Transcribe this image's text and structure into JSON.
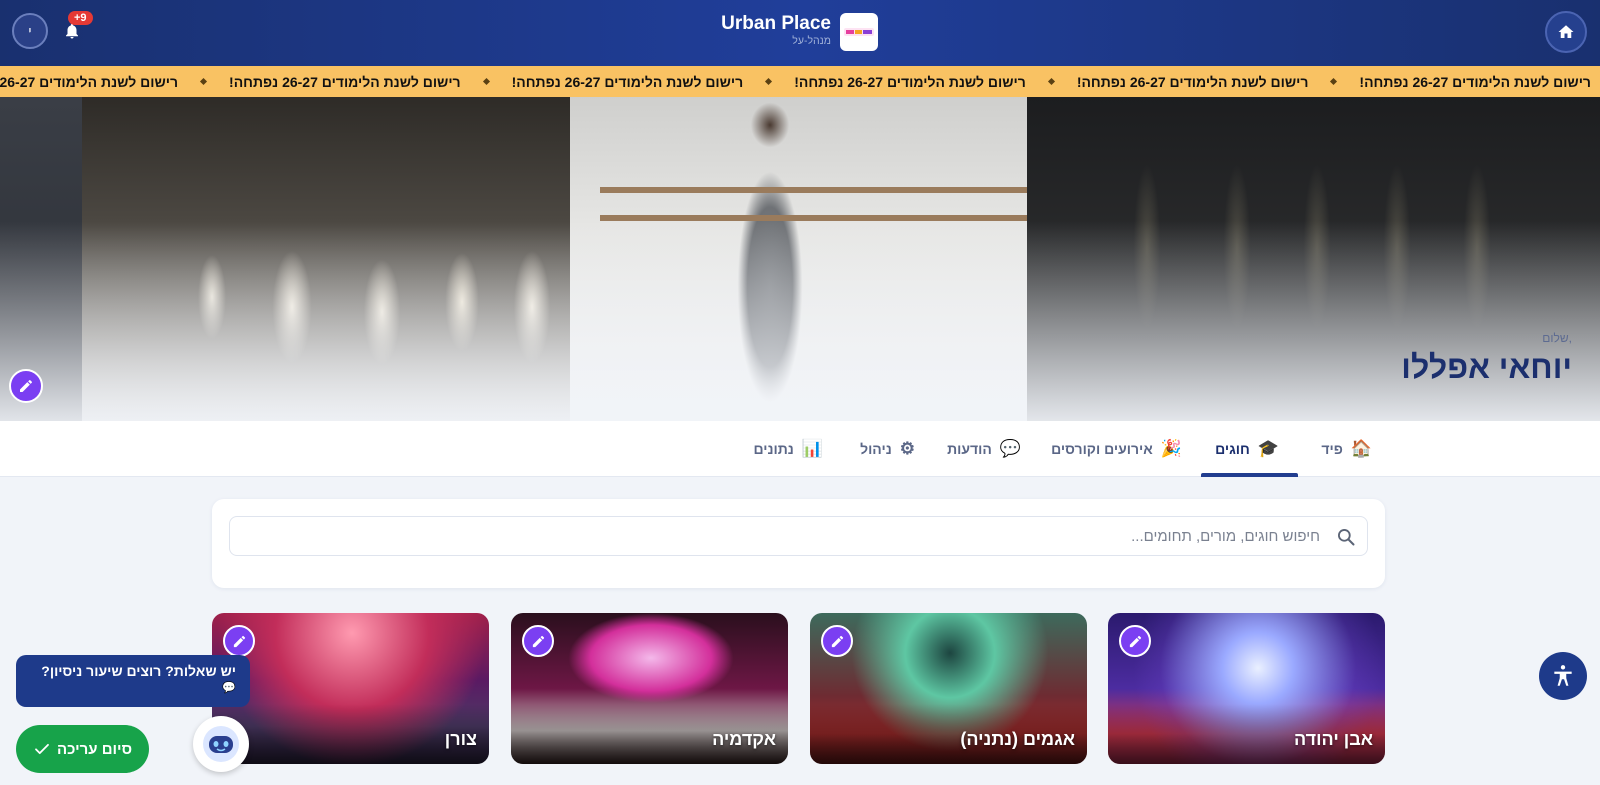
{
  "header": {
    "brand_title": "Urban Place",
    "brand_subtitle": "מנהל-על",
    "brand_logo_text": "Urban Place",
    "notification_count": "+9",
    "avatar_initial": "י",
    "icons": {
      "home": "home-icon",
      "bell": "bell-icon"
    }
  },
  "ticker": {
    "items": [
      "רישום לשנת הלימודים 26-27 נפתחה!",
      "רישום לשנת הלימודים 26-27 נפתחה!",
      "רישום לשנת הלימודים 26-27 נפתחה!",
      "רישום לשנת הלימודים 26-27 נפתחה!",
      "רישום לשנת הלימודים 26-27 נפתחה!",
      "רישום לשנת הלימודים 26-27 נפתחה!"
    ]
  },
  "hero": {
    "greeting": "שלום,",
    "user_name": "יוחאי אפללו"
  },
  "tabs": [
    {
      "label": "פיד",
      "icon": "🏠",
      "active": false
    },
    {
      "label": "חוגים",
      "icon": "🎓",
      "active": true
    },
    {
      "label": "אירועים וקורסים",
      "icon": "🎉",
      "active": false
    },
    {
      "label": "הודעות",
      "icon": "💬",
      "active": false
    },
    {
      "label": "ניהול",
      "icon": "⚙",
      "active": false
    },
    {
      "label": "נתונים",
      "icon": "📊",
      "active": false
    }
  ],
  "search": {
    "placeholder": "חיפוש חוגים, מורים, תחומים..."
  },
  "cards": [
    {
      "title": "אבן יהודה"
    },
    {
      "title": "אגמים (נתניה)"
    },
    {
      "title": "אקדמיה"
    },
    {
      "title": "צורן"
    }
  ],
  "chat": {
    "bubble_text": "יש שאלות? רוצים שיעור ניסיון?",
    "bubble_icon": "💬"
  },
  "finish_button": {
    "label": "סיום עריכה"
  },
  "colors": {
    "header": "#1d3580",
    "ticker": "#f9c263",
    "accent_purple": "#7b3ff2",
    "finish_green": "#17a34a",
    "primary_navy": "#1b2f6e"
  }
}
